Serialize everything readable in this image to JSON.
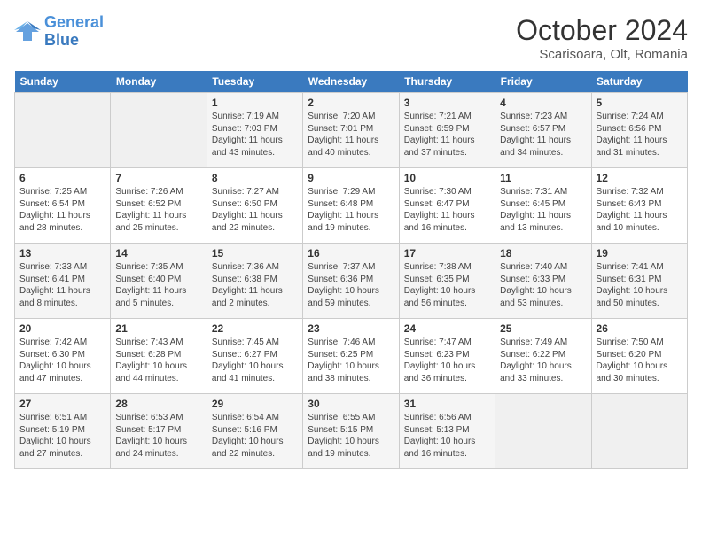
{
  "header": {
    "logo_line1": "General",
    "logo_line2": "Blue",
    "month": "October 2024",
    "location": "Scarisoara, Olt, Romania"
  },
  "weekdays": [
    "Sunday",
    "Monday",
    "Tuesday",
    "Wednesday",
    "Thursday",
    "Friday",
    "Saturday"
  ],
  "weeks": [
    [
      {
        "day": "",
        "sunrise": "",
        "sunset": "",
        "daylight": ""
      },
      {
        "day": "",
        "sunrise": "",
        "sunset": "",
        "daylight": ""
      },
      {
        "day": "1",
        "sunrise": "Sunrise: 7:19 AM",
        "sunset": "Sunset: 7:03 PM",
        "daylight": "Daylight: 11 hours and 43 minutes."
      },
      {
        "day": "2",
        "sunrise": "Sunrise: 7:20 AM",
        "sunset": "Sunset: 7:01 PM",
        "daylight": "Daylight: 11 hours and 40 minutes."
      },
      {
        "day": "3",
        "sunrise": "Sunrise: 7:21 AM",
        "sunset": "Sunset: 6:59 PM",
        "daylight": "Daylight: 11 hours and 37 minutes."
      },
      {
        "day": "4",
        "sunrise": "Sunrise: 7:23 AM",
        "sunset": "Sunset: 6:57 PM",
        "daylight": "Daylight: 11 hours and 34 minutes."
      },
      {
        "day": "5",
        "sunrise": "Sunrise: 7:24 AM",
        "sunset": "Sunset: 6:56 PM",
        "daylight": "Daylight: 11 hours and 31 minutes."
      }
    ],
    [
      {
        "day": "6",
        "sunrise": "Sunrise: 7:25 AM",
        "sunset": "Sunset: 6:54 PM",
        "daylight": "Daylight: 11 hours and 28 minutes."
      },
      {
        "day": "7",
        "sunrise": "Sunrise: 7:26 AM",
        "sunset": "Sunset: 6:52 PM",
        "daylight": "Daylight: 11 hours and 25 minutes."
      },
      {
        "day": "8",
        "sunrise": "Sunrise: 7:27 AM",
        "sunset": "Sunset: 6:50 PM",
        "daylight": "Daylight: 11 hours and 22 minutes."
      },
      {
        "day": "9",
        "sunrise": "Sunrise: 7:29 AM",
        "sunset": "Sunset: 6:48 PM",
        "daylight": "Daylight: 11 hours and 19 minutes."
      },
      {
        "day": "10",
        "sunrise": "Sunrise: 7:30 AM",
        "sunset": "Sunset: 6:47 PM",
        "daylight": "Daylight: 11 hours and 16 minutes."
      },
      {
        "day": "11",
        "sunrise": "Sunrise: 7:31 AM",
        "sunset": "Sunset: 6:45 PM",
        "daylight": "Daylight: 11 hours and 13 minutes."
      },
      {
        "day": "12",
        "sunrise": "Sunrise: 7:32 AM",
        "sunset": "Sunset: 6:43 PM",
        "daylight": "Daylight: 11 hours and 10 minutes."
      }
    ],
    [
      {
        "day": "13",
        "sunrise": "Sunrise: 7:33 AM",
        "sunset": "Sunset: 6:41 PM",
        "daylight": "Daylight: 11 hours and 8 minutes."
      },
      {
        "day": "14",
        "sunrise": "Sunrise: 7:35 AM",
        "sunset": "Sunset: 6:40 PM",
        "daylight": "Daylight: 11 hours and 5 minutes."
      },
      {
        "day": "15",
        "sunrise": "Sunrise: 7:36 AM",
        "sunset": "Sunset: 6:38 PM",
        "daylight": "Daylight: 11 hours and 2 minutes."
      },
      {
        "day": "16",
        "sunrise": "Sunrise: 7:37 AM",
        "sunset": "Sunset: 6:36 PM",
        "daylight": "Daylight: 10 hours and 59 minutes."
      },
      {
        "day": "17",
        "sunrise": "Sunrise: 7:38 AM",
        "sunset": "Sunset: 6:35 PM",
        "daylight": "Daylight: 10 hours and 56 minutes."
      },
      {
        "day": "18",
        "sunrise": "Sunrise: 7:40 AM",
        "sunset": "Sunset: 6:33 PM",
        "daylight": "Daylight: 10 hours and 53 minutes."
      },
      {
        "day": "19",
        "sunrise": "Sunrise: 7:41 AM",
        "sunset": "Sunset: 6:31 PM",
        "daylight": "Daylight: 10 hours and 50 minutes."
      }
    ],
    [
      {
        "day": "20",
        "sunrise": "Sunrise: 7:42 AM",
        "sunset": "Sunset: 6:30 PM",
        "daylight": "Daylight: 10 hours and 47 minutes."
      },
      {
        "day": "21",
        "sunrise": "Sunrise: 7:43 AM",
        "sunset": "Sunset: 6:28 PM",
        "daylight": "Daylight: 10 hours and 44 minutes."
      },
      {
        "day": "22",
        "sunrise": "Sunrise: 7:45 AM",
        "sunset": "Sunset: 6:27 PM",
        "daylight": "Daylight: 10 hours and 41 minutes."
      },
      {
        "day": "23",
        "sunrise": "Sunrise: 7:46 AM",
        "sunset": "Sunset: 6:25 PM",
        "daylight": "Daylight: 10 hours and 38 minutes."
      },
      {
        "day": "24",
        "sunrise": "Sunrise: 7:47 AM",
        "sunset": "Sunset: 6:23 PM",
        "daylight": "Daylight: 10 hours and 36 minutes."
      },
      {
        "day": "25",
        "sunrise": "Sunrise: 7:49 AM",
        "sunset": "Sunset: 6:22 PM",
        "daylight": "Daylight: 10 hours and 33 minutes."
      },
      {
        "day": "26",
        "sunrise": "Sunrise: 7:50 AM",
        "sunset": "Sunset: 6:20 PM",
        "daylight": "Daylight: 10 hours and 30 minutes."
      }
    ],
    [
      {
        "day": "27",
        "sunrise": "Sunrise: 6:51 AM",
        "sunset": "Sunset: 5:19 PM",
        "daylight": "Daylight: 10 hours and 27 minutes."
      },
      {
        "day": "28",
        "sunrise": "Sunrise: 6:53 AM",
        "sunset": "Sunset: 5:17 PM",
        "daylight": "Daylight: 10 hours and 24 minutes."
      },
      {
        "day": "29",
        "sunrise": "Sunrise: 6:54 AM",
        "sunset": "Sunset: 5:16 PM",
        "daylight": "Daylight: 10 hours and 22 minutes."
      },
      {
        "day": "30",
        "sunrise": "Sunrise: 6:55 AM",
        "sunset": "Sunset: 5:15 PM",
        "daylight": "Daylight: 10 hours and 19 minutes."
      },
      {
        "day": "31",
        "sunrise": "Sunrise: 6:56 AM",
        "sunset": "Sunset: 5:13 PM",
        "daylight": "Daylight: 10 hours and 16 minutes."
      },
      {
        "day": "",
        "sunrise": "",
        "sunset": "",
        "daylight": ""
      },
      {
        "day": "",
        "sunrise": "",
        "sunset": "",
        "daylight": ""
      }
    ]
  ]
}
